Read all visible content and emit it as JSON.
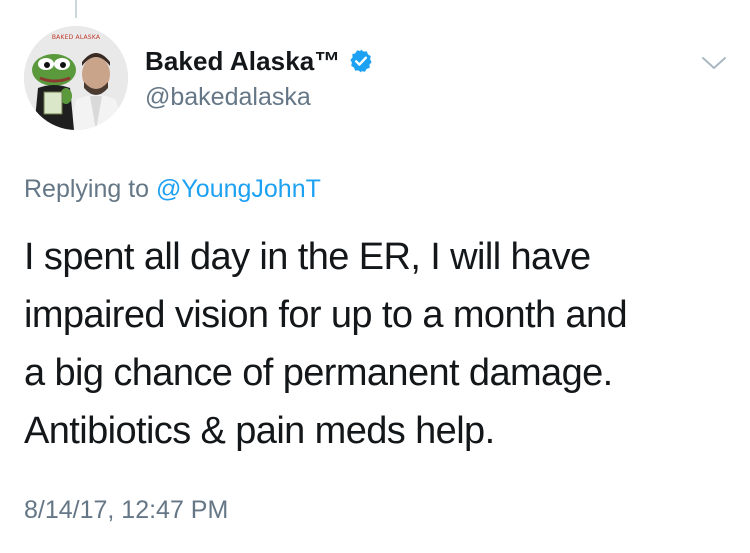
{
  "tweet": {
    "author": {
      "display_name": "Baked Alaska™",
      "handle": "@bakedalaska",
      "verified": true,
      "avatar_caption": "BAKED ALASKA"
    },
    "replying_to_prefix": "Replying to",
    "replying_to_handle": "@YoungJohnT",
    "text_lines": [
      "I spent all day in the ER, I will have",
      "impaired vision for up to a month and",
      "a big chance of permanent damage.",
      "Antibiotics & pain meds help."
    ],
    "timestamp": "8/14/17, 12:47 PM"
  },
  "icons": {
    "verified": "verified-badge-icon",
    "menu": "chevron-down-icon"
  },
  "colors": {
    "link": "#1da1f2",
    "secondary_text": "#657786",
    "primary_text": "#14171a",
    "verified": "#1da1f2"
  }
}
